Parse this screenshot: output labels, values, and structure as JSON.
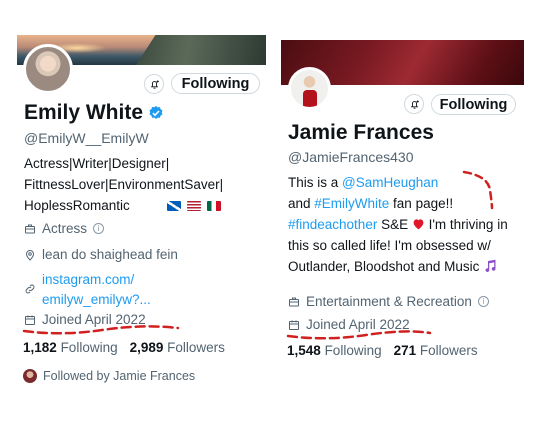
{
  "left_profile": {
    "display_name": "Emily White",
    "handle": "@EmilyW__EmilyW",
    "follow_button_label": "Following",
    "bio_lines": [
      "Actress|Writer|Designer|",
      "FittnessLover|EnvironmentSaver|",
      "HoplessRomantic"
    ],
    "category": "Actress",
    "location": "lean do shaighead fein",
    "website_line1": "instagram.com/",
    "website_line2": "emilyw_emilyw?...",
    "joined": "Joined April 2022",
    "following_count": "1,182",
    "following_label": "Following",
    "followers_count": "2,989",
    "followers_label": "Followers",
    "followed_by": "Followed by Jamie Frances"
  },
  "right_profile": {
    "display_name": "Jamie Frances",
    "handle": "@JamieFrances430",
    "follow_button_label": "Following",
    "bio_part1": "This is a ",
    "bio_mention": "@SamHeughan",
    "bio_part2": "and ",
    "bio_hashtag1": "#EmilyWhite",
    "bio_part3": " fan page!!",
    "bio_hashtag2": "#findeachother",
    "bio_part4": " S&E ",
    "bio_part5": " I'm thriving in this so called life! I'm obsessed w/ Outlander, Bloodshot and Music ",
    "category": "Entertainment & Recreation",
    "joined": "Joined April 2022",
    "following_count": "1,548",
    "following_label": "Following",
    "followers_count": "271",
    "followers_label": "Followers"
  },
  "colors": {
    "link_blue": "#1d9bf0",
    "annotation_red": "#d0201f",
    "muted_text": "#536471"
  },
  "icons": [
    "bell-plus-icon",
    "verified-badge-icon",
    "briefcase-icon",
    "info-icon",
    "location-pin-icon",
    "link-icon",
    "calendar-icon",
    "heart-emoji",
    "music-notes-emoji"
  ]
}
